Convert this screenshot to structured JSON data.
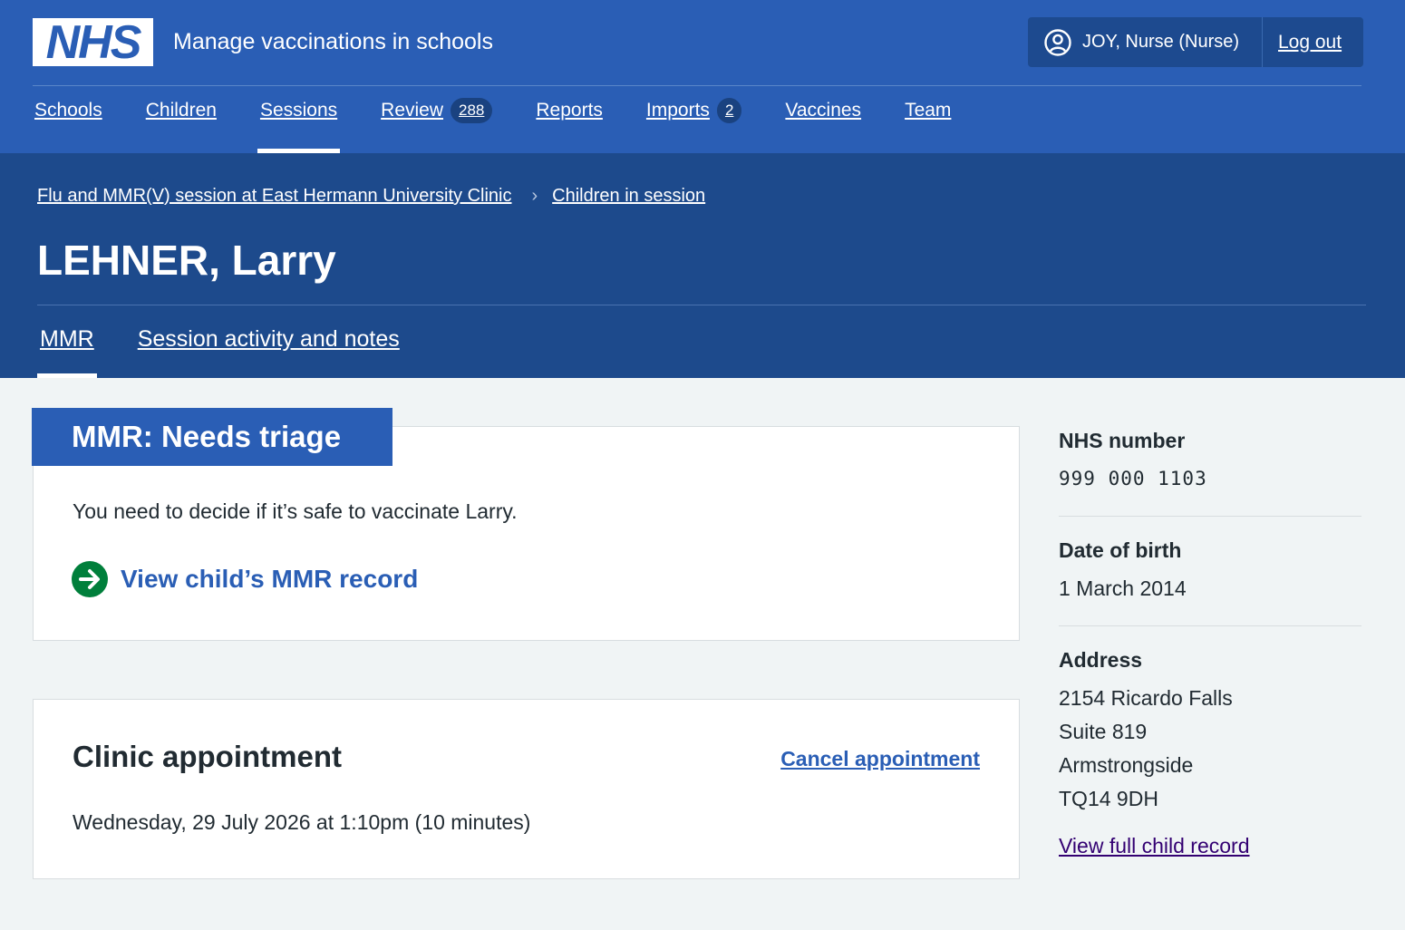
{
  "header": {
    "logo_text": "NHS",
    "service_name": "Manage vaccinations in schools",
    "user_label": "JOY, Nurse (Nurse)",
    "logout_label": "Log out",
    "nav": [
      {
        "label": "Schools"
      },
      {
        "label": "Children"
      },
      {
        "label": "Sessions"
      },
      {
        "label": "Review",
        "count": "288"
      },
      {
        "label": "Reports"
      },
      {
        "label": "Imports",
        "count": "2"
      },
      {
        "label": "Vaccines"
      },
      {
        "label": "Team"
      }
    ]
  },
  "breadcrumb": [
    {
      "label": "Flu and MMR(V) session at East Hermann University Clinic"
    },
    {
      "label": "Children in session"
    }
  ],
  "page_title": "LEHNER, Larry",
  "subnav": [
    {
      "label": "MMR"
    },
    {
      "label": "Session activity and notes"
    }
  ],
  "status_card": {
    "heading": "MMR: Needs triage",
    "text": "You need to decide if it’s safe to vaccinate Larry.",
    "action_label": "View child’s MMR record"
  },
  "appointment_card": {
    "title": "Clinic appointment",
    "cancel_label": "Cancel appointment",
    "time": "Wednesday, 29 July 2026 at 1:10pm (10 minutes)"
  },
  "summary": {
    "nhs_number_label": "NHS number",
    "nhs_number": "999 000 1103",
    "dob_label": "Date of birth",
    "dob": "1 March 2014",
    "address_label": "Address",
    "address_lines": [
      "2154 Ricardo Falls",
      "Suite 819",
      "Armstrongside",
      "TQ14 9DH"
    ],
    "full_record_label": "View full child record"
  },
  "colors": {
    "header_blue": "#2a5eb5",
    "band_blue": "#1d4a8c",
    "page_bg": "#f0f4f5",
    "action_green": "#007f3b",
    "visited_link": "#330072"
  }
}
